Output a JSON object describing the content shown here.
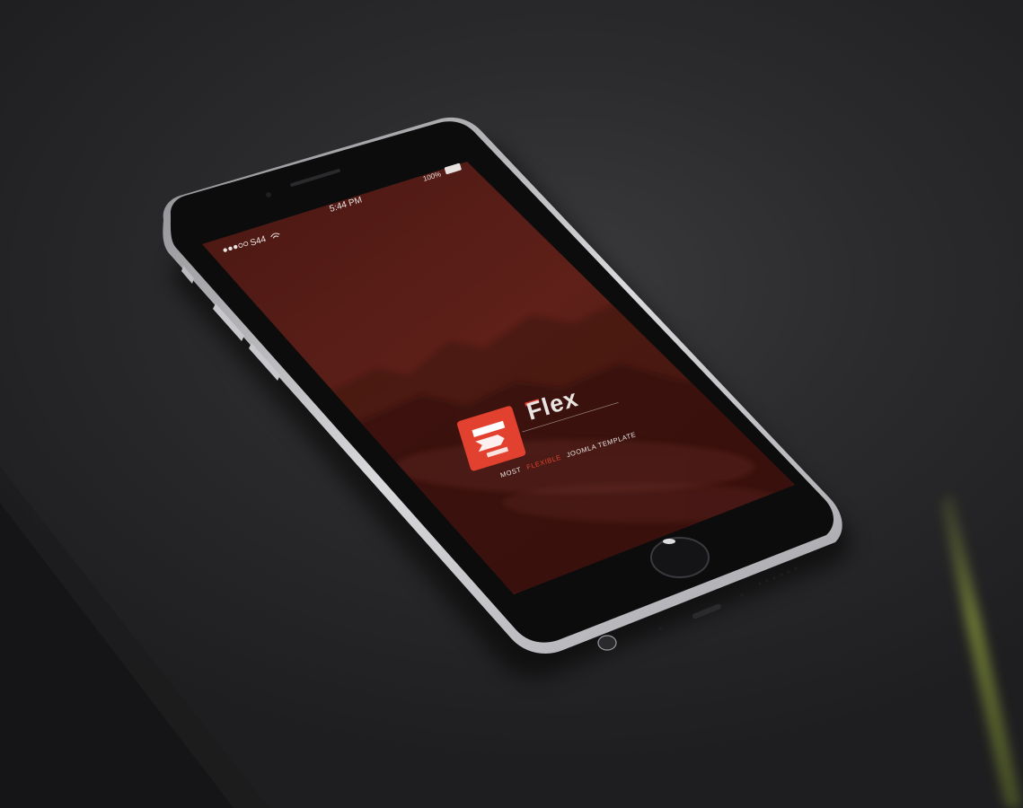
{
  "status_bar": {
    "carrier": "S44",
    "time": "5:44 PM",
    "battery_percent_label": "100%"
  },
  "splash": {
    "brand_name": "Flex",
    "tagline_part1": "MOST",
    "tagline_highlight": "FLEXIBLE",
    "tagline_part2": "JOOMLA TEMPLATE"
  },
  "colors": {
    "screen_red": "#5a1e18",
    "logo_red": "#e2412f",
    "highlight": "#e2412f",
    "background": "#2b2b2d"
  }
}
